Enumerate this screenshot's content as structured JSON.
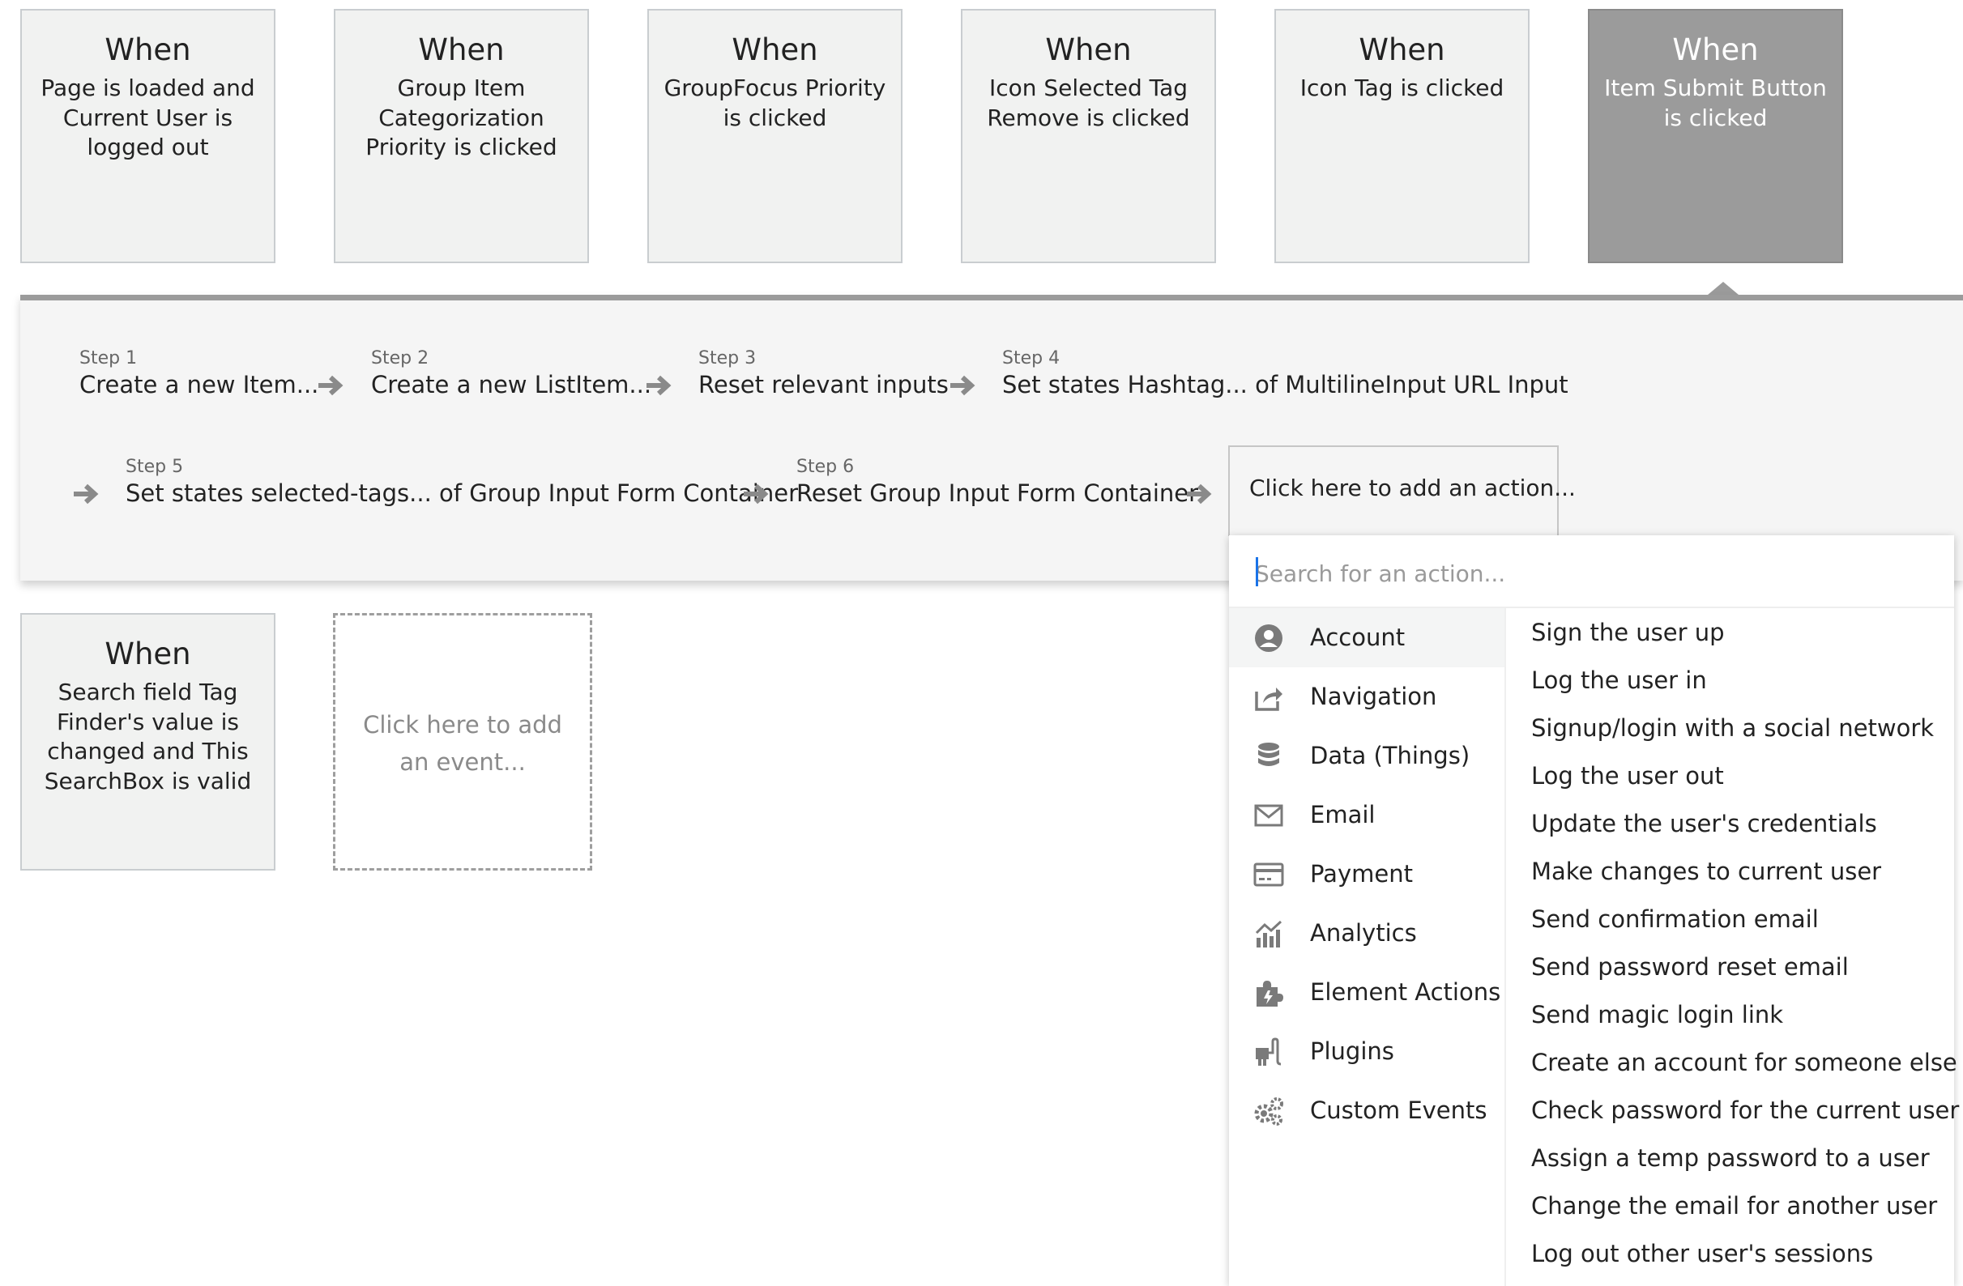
{
  "events": [
    {
      "when": "When",
      "text": "Page is loaded and Current User is logged out"
    },
    {
      "when": "When",
      "text": "Group Item Categorization Priority is clicked"
    },
    {
      "when": "When",
      "text": "GroupFocus Priority is clicked"
    },
    {
      "when": "When",
      "text": "Icon Selected Tag Remove is clicked"
    },
    {
      "when": "When",
      "text": "Icon Tag is clicked"
    },
    {
      "when": "When",
      "text": "Item Submit Button is clicked"
    }
  ],
  "events_row2": [
    {
      "when": "When",
      "text": "Search field Tag Finder's value is changed and This SearchBox is valid"
    }
  ],
  "add_event_label": "Click here to add an event...",
  "workflow": {
    "steps": [
      {
        "num": "Step 1",
        "text": "Create a new Item..."
      },
      {
        "num": "Step 2",
        "text": "Create a new ListItem..."
      },
      {
        "num": "Step 3",
        "text": "Reset relevant inputs"
      },
      {
        "num": "Step 4",
        "text": "Set states Hashtag... of MultilineInput URL Input"
      },
      {
        "num": "Step 5",
        "text": "Set states selected-tags... of Group Input Form Container"
      },
      {
        "num": "Step 6",
        "text": "Reset Group Input Form Container"
      }
    ],
    "add_action_label": "Click here to add an action..."
  },
  "action_dropdown": {
    "search_placeholder": "Search for an action...",
    "categories": [
      {
        "label": "Account",
        "icon": "account-icon"
      },
      {
        "label": "Navigation",
        "icon": "navigation-icon"
      },
      {
        "label": "Data (Things)",
        "icon": "database-icon"
      },
      {
        "label": "Email",
        "icon": "email-icon"
      },
      {
        "label": "Payment",
        "icon": "credit-card-icon"
      },
      {
        "label": "Analytics",
        "icon": "analytics-icon"
      },
      {
        "label": "Element Actions",
        "icon": "puzzle-icon"
      },
      {
        "label": "Plugins",
        "icon": "plug-icon"
      },
      {
        "label": "Custom Events",
        "icon": "gears-icon"
      }
    ],
    "actions": [
      "Sign the user up",
      "Log the user in",
      "Signup/login with a social network",
      "Log the user out",
      "Update the user's credentials",
      "Make changes to current user",
      "Send confirmation email",
      "Send password reset email",
      "Send magic login link",
      "Create an account for someone else",
      "Check password for the current user",
      "Assign a temp password to a user",
      "Change the email for another user",
      "Log out other user's sessions"
    ]
  },
  "colors": {
    "card_bg": "#f1f2f1",
    "card_selected_bg": "#9b9b9b",
    "panel_bg": "#f5f5f5",
    "accent_caret": "#1a73e8",
    "arrow": "#8a8a8a"
  }
}
